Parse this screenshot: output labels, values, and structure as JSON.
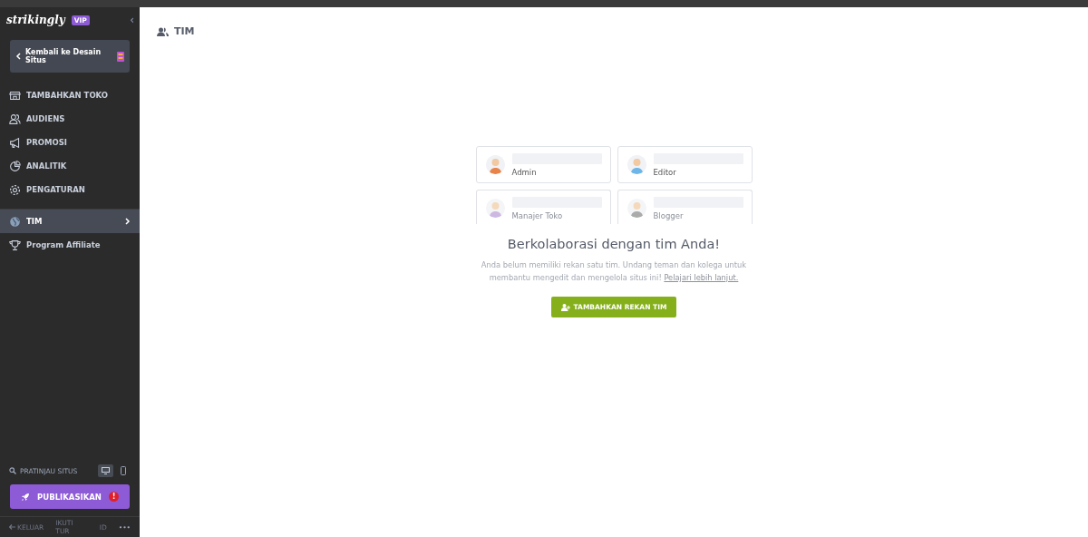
{
  "sidebar": {
    "logo": "strikingly",
    "badge": "VIP",
    "back_button": "Kembali ke Desain Situs",
    "collapse": "‹",
    "items": [
      {
        "label": "TAMBAHKAN TOKO",
        "selected": false
      },
      {
        "label": "AUDIENS",
        "selected": false
      },
      {
        "label": "PROMOSI",
        "selected": false
      },
      {
        "label": "ANALITIK",
        "selected": false
      },
      {
        "label": "PENGATURAN",
        "selected": false
      },
      {
        "label": "TIM",
        "selected": true
      },
      {
        "label": "Program Affiliate",
        "selected": false
      }
    ],
    "preview": {
      "label": "PRATINJAU SITUS",
      "devices": [
        {
          "kind": "desktop",
          "selected": true
        },
        {
          "kind": "mobile",
          "selected": false
        }
      ]
    },
    "publish_button": "PUBLIKASIKAN",
    "publish_alert": "!",
    "footer": [
      "KELUAR",
      "IKUTI TUR",
      "ID",
      "•••"
    ]
  },
  "header": {
    "title": "TIM"
  },
  "roles": [
    {
      "label": "Admin",
      "faded": false
    },
    {
      "label": "Editor",
      "faded": false
    },
    {
      "label": "Manajer Toko",
      "faded": true
    },
    {
      "label": "Blogger",
      "faded": true
    }
  ],
  "empty": {
    "heading": "Berkolaborasi dengan tim Anda!",
    "text": "Anda belum memiliki rekan satu tim. Undang teman dan kolega untuk membantu mengedit dan mengelola situs ini!",
    "link": "Pelajari lebih lanjut.",
    "button": "TAMBAHKAN REKAN TIM"
  }
}
